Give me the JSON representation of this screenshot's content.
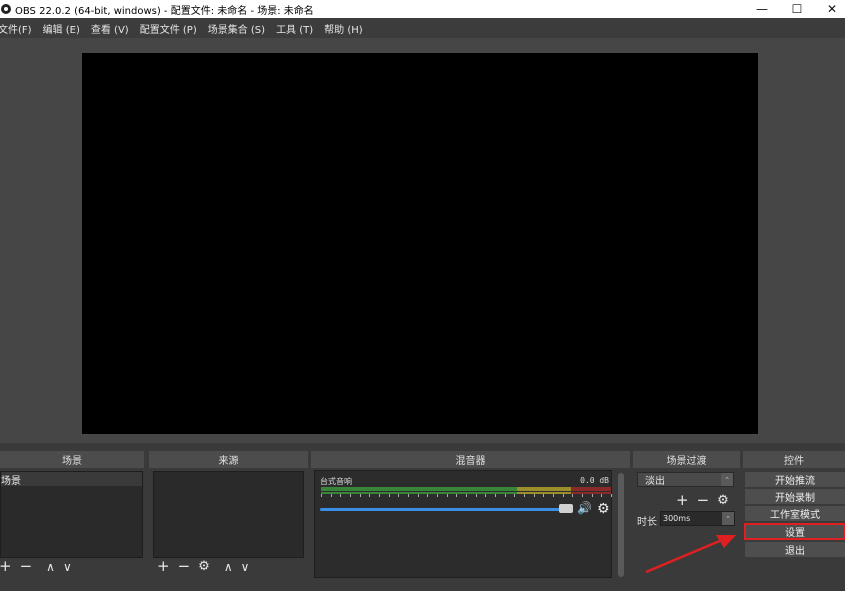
{
  "window": {
    "title": "OBS 22.0.2 (64-bit, windows) - 配置文件: 未命名 - 场景: 未命名",
    "min_icon": "minimize-icon",
    "max_icon": "maximize-icon",
    "close_icon": "close-icon",
    "min_glyph": "—",
    "max_glyph": "☐",
    "close_glyph": "✕"
  },
  "menu": [
    "文件(F)",
    "编辑 (E)",
    "查看 (V)",
    "配置文件 (P)",
    "场景集合 (S)",
    "工具 (T)",
    "帮助 (H)"
  ],
  "docks": {
    "scenes": {
      "title": "场景",
      "items": [
        "场景"
      ]
    },
    "sources": {
      "title": "来源"
    },
    "mixer": {
      "title": "混音器",
      "channel_name": "台式音响",
      "db": "0.0 dB",
      "volume_level": 1.0
    },
    "transitions": {
      "title": "场景过渡",
      "selected": "淡出",
      "duration_label": "时长",
      "duration_value": "300ms"
    },
    "controls": {
      "title": "控件",
      "buttons": [
        "开始推流",
        "开始录制",
        "工作室模式",
        "设置",
        "退出"
      ],
      "highlighted_index": 3
    }
  },
  "toolbar_glyphs": {
    "add": "+",
    "remove": "−",
    "gear": "⚙",
    "up": "∧",
    "down": "∨",
    "speaker": "🔊",
    "spin": "⌃"
  },
  "annotation_color": "#e02020"
}
